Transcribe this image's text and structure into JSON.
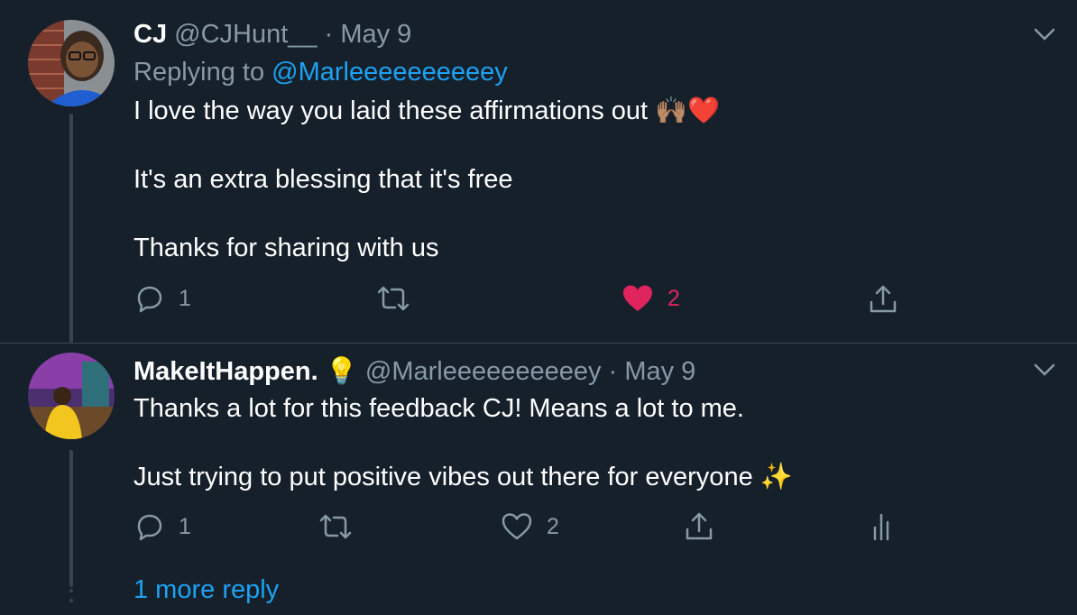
{
  "tweets": [
    {
      "name": "CJ",
      "handle": "@CJHunt__",
      "dot": "·",
      "date": "May 9",
      "replying_label": "Replying to",
      "replying_to": "@Marleeeeeeeeeey",
      "lines": [
        "I love the way you laid these affirmations out",
        "It's an extra blessing that it's free",
        "Thanks for sharing with us"
      ],
      "emoji_line1": "🙌🏽❤️",
      "actions": {
        "reply_count": "1",
        "retweet_count": "",
        "like_count": "2",
        "liked": true
      }
    },
    {
      "name": "MakeItHappen.",
      "name_emoji": "💡",
      "handle": "@Marleeeeeeeeeey",
      "dot": "·",
      "date": "May 9",
      "lines": [
        "Thanks a lot for this feedback CJ! Means a lot to me.",
        "Just trying to put positive vibes out there for everyone"
      ],
      "emoji_line2": "✨",
      "actions": {
        "reply_count": "1",
        "retweet_count": "",
        "like_count": "2",
        "liked": false
      }
    }
  ],
  "more_replies": "1 more reply",
  "colors": {
    "background": "#15202b",
    "accent": "#1da1f2",
    "muted": "#8899a6",
    "like": "#e0245e"
  },
  "icons": [
    "chevron-down-icon",
    "reply-icon",
    "retweet-icon",
    "heart-icon",
    "share-icon",
    "analytics-icon"
  ]
}
